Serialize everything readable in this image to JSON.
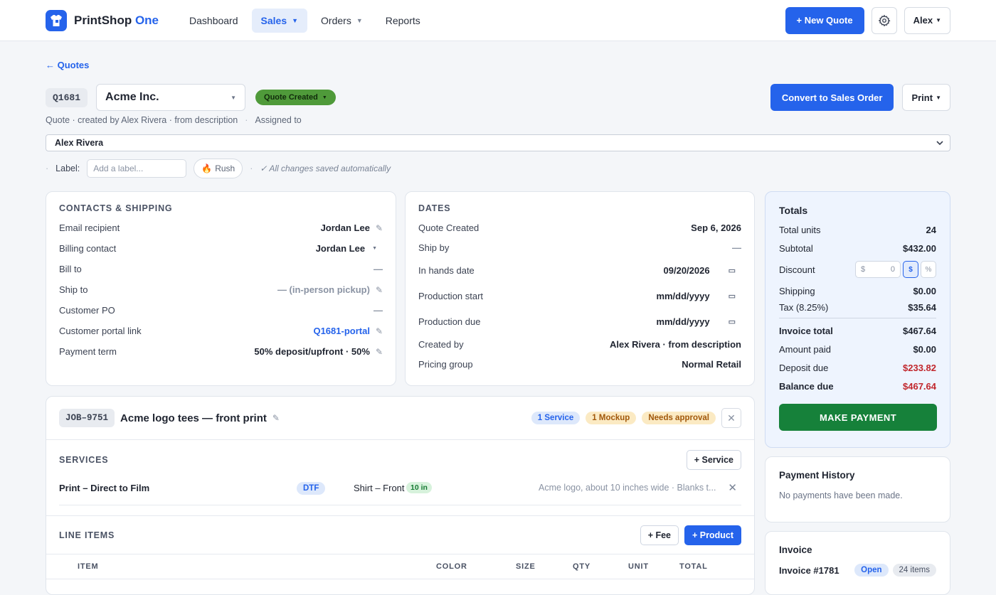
{
  "brand": {
    "name_part1": "PrintShop",
    "name_part2": "One",
    "accent": "#2563eb"
  },
  "nav": {
    "dashboard": "Dashboard",
    "sales": "Sales",
    "orders": "Orders",
    "reports": "Reports",
    "caret": "▼"
  },
  "top": {
    "new_quote": "+ New Quote",
    "user": "Alex"
  },
  "quote": {
    "back": "← Quotes",
    "id": "Q1681",
    "customer": "Acme Inc.",
    "status": "Quote Created",
    "status_color": "#4f9a3a",
    "convert": "Convert to Sales Order",
    "print": "Print",
    "subline": "Quote · created by Alex Rivera · from description",
    "sep": "·",
    "assigned_label": "Assigned to",
    "assignee": "Alex Rivera",
    "label_label": "Label:",
    "label_placeholder": "Add a label...",
    "rush": "Rush",
    "saved": "✓ All changes saved automatically"
  },
  "contacts": {
    "title": "CONTACTS & SHIPPING",
    "rows": [
      {
        "k": "Email recipient",
        "v": "Jordan Lee"
      },
      {
        "k": "Billing contact",
        "v": "Jordan Lee"
      },
      {
        "k": "Bill to",
        "v": "—"
      },
      {
        "k": "Ship to",
        "v": "— (in-person pickup)"
      },
      {
        "k": "Customer PO",
        "v": "—"
      },
      {
        "k": "Customer portal link",
        "v": "Q1681-portal"
      },
      {
        "k": "Payment term",
        "v": "50% deposit/upfront · 50%"
      }
    ]
  },
  "dates": {
    "title": "DATES",
    "rows": [
      {
        "k": "Quote Created",
        "v": "Sep 6, 2026"
      },
      {
        "k": "Ship by",
        "v": "—"
      },
      {
        "k": "In hands date",
        "v": "09/20/2026"
      },
      {
        "k": "Production start",
        "v": "mm/dd/yyyy"
      },
      {
        "k": "Production due",
        "v": "mm/dd/yyyy"
      },
      {
        "k": "Created by",
        "v": "Alex Rivera · from description"
      },
      {
        "k": "Pricing group",
        "v": "Normal Retail"
      }
    ]
  },
  "totals": {
    "title": "Totals",
    "total_units_label": "Total units",
    "total_units": "24",
    "subtotal_label": "Subtotal",
    "subtotal": "$432.00",
    "discount_label": "Discount",
    "discount_prefix": "$",
    "discount_value": "0",
    "disc_dollar": "$",
    "disc_percent": "%",
    "shipping_label": "Shipping",
    "shipping": "$0.00",
    "tax_label": "Tax (8.25%)",
    "tax": "$35.64",
    "invoice_total_label": "Invoice total",
    "invoice_total": "$467.64",
    "amount_paid_label": "Amount paid",
    "amount_paid": "$0.00",
    "deposit_due_label": "Deposit due",
    "deposit_due": "$233.82",
    "balance_due_label": "Balance due",
    "balance_due": "$467.64",
    "make_payment": "MAKE PAYMENT"
  },
  "payment_history": {
    "title": "Payment History",
    "empty": "No payments have been made."
  },
  "invoice": {
    "title": "Invoice",
    "number": "Invoice #1781",
    "status": "Open",
    "items": "24 items"
  },
  "job": {
    "id": "JOB–9751",
    "title": "Acme logo tees — front print",
    "badge_service": "1 Service",
    "badge_mockup": "1 Mockup",
    "badge_approval": "Needs approval",
    "services_title": "SERVICES",
    "add_service": "+ Service",
    "service": {
      "name": "Print – Direct to Film",
      "method": "DTF",
      "location": "Shirt – Front",
      "size": "10 in",
      "notes": "Acme logo, about 10 inches wide · Blanks t..."
    },
    "line_items_title": "LINE ITEMS",
    "add_fee": "+ Fee",
    "add_product": "+ Product",
    "columns": {
      "item": "ITEM",
      "color": "COLOR",
      "size": "SIZE",
      "qty": "QTY",
      "unit": "UNIT",
      "total": "TOTAL"
    }
  }
}
